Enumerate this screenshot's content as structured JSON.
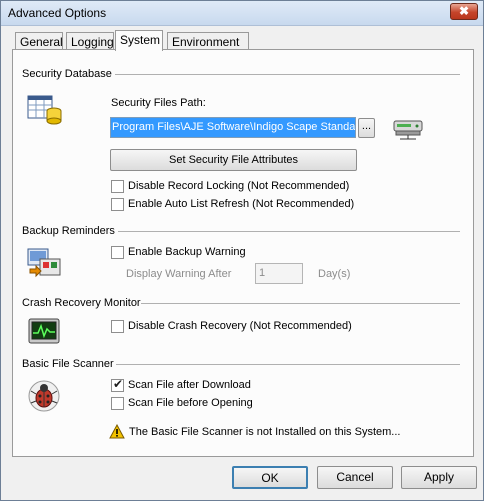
{
  "window": {
    "title": "Advanced Options",
    "close_glyph": "✖"
  },
  "tabs": [
    {
      "label": "General"
    },
    {
      "label": "Logging"
    },
    {
      "label": "System"
    },
    {
      "label": "Environment"
    }
  ],
  "active_tab": "System",
  "security": {
    "section_title": "Security Database",
    "path_label": "Security Files Path:",
    "path_value": "Program Files\\AJE Software\\Indigo Scape Standard",
    "browse_label": "...",
    "attr_button": "Set Security File Attributes",
    "options": [
      {
        "label": "Disable Record Locking (Not Recommended)",
        "checked": false
      },
      {
        "label": "Enable Auto List Refresh (Not Recommended)",
        "checked": false
      }
    ]
  },
  "backup": {
    "section_title": "Backup Reminders",
    "enable_label": "Enable Backup Warning",
    "enable_checked": false,
    "display_after_label": "Display Warning After",
    "days_value": "1",
    "days_unit": "Day(s)"
  },
  "crash": {
    "section_title": "Crash Recovery Monitor",
    "option_label": "Disable Crash Recovery (Not Recommended)",
    "option_checked": false
  },
  "scanner": {
    "section_title": "Basic File Scanner",
    "options": [
      {
        "label": "Scan File after Download",
        "checked": true
      },
      {
        "label": "Scan File before Opening",
        "checked": false
      }
    ],
    "warning_text": "The Basic File Scanner is not Installed on this System..."
  },
  "buttons": {
    "ok": "OK",
    "cancel": "Cancel",
    "apply": "Apply"
  },
  "colors": {
    "selection": "#3399ff",
    "warning": "#f2c200",
    "title_gradient_top": "#dfeaf7"
  },
  "icons": [
    "database-icon",
    "server-icon",
    "backup-icon",
    "monitor-icon",
    "bug-icon",
    "warning-icon"
  ]
}
